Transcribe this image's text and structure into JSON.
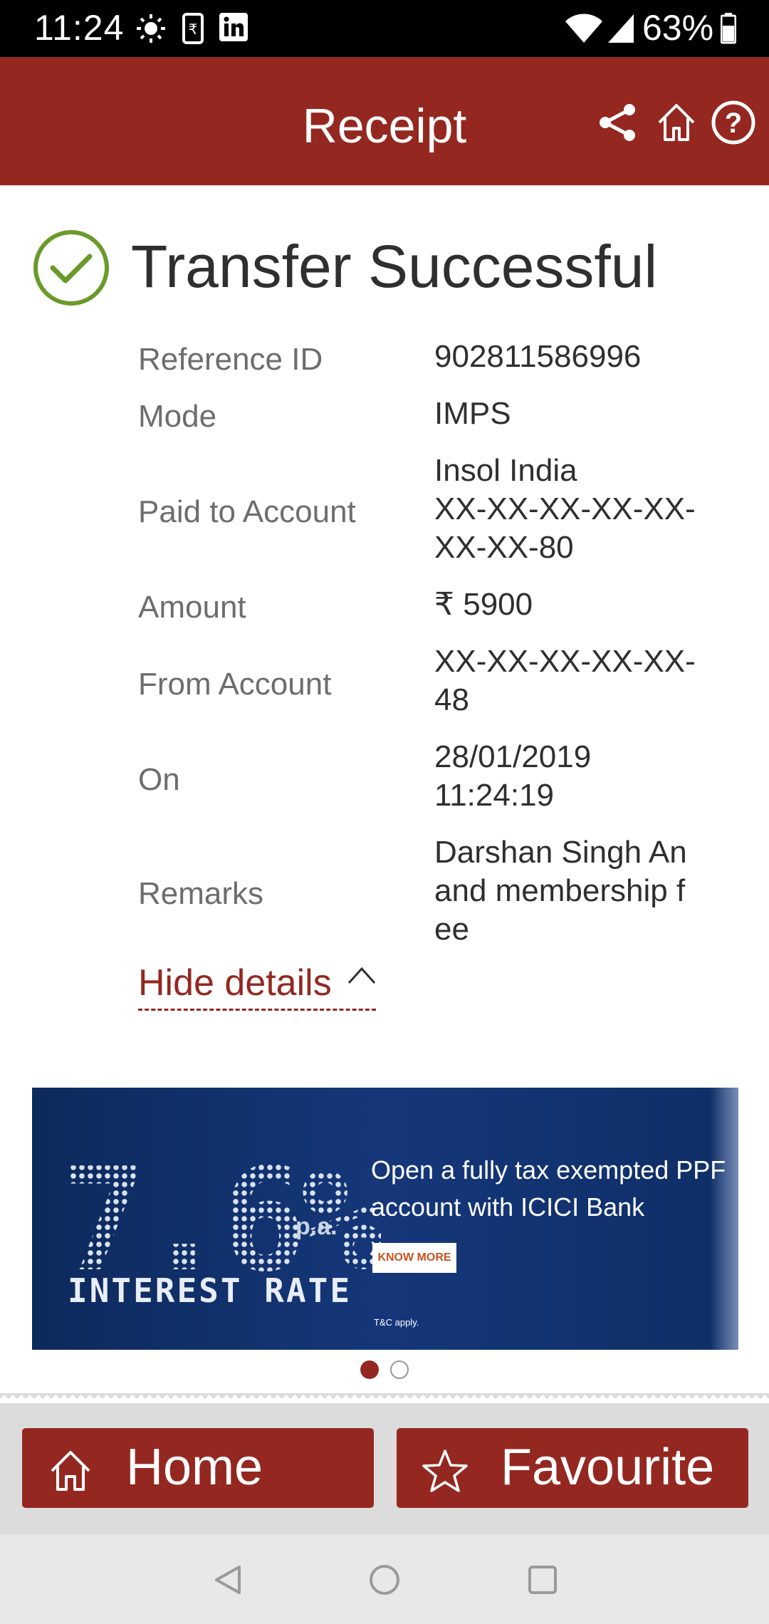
{
  "status_bar": {
    "time": "11:24",
    "battery": "63%"
  },
  "header": {
    "title": "Receipt"
  },
  "receipt": {
    "status": "Transfer Successful",
    "rows": [
      {
        "label": "Reference ID",
        "value": "902811586996"
      },
      {
        "label": "Mode",
        "value": "IMPS"
      },
      {
        "label": "Paid to Account",
        "value": "Insol India\nXX-XX-XX-XX-XX-\nXX-XX-80"
      },
      {
        "label": "Amount",
        "value": "₹ 5900"
      },
      {
        "label": "From Account",
        "value": "XX-XX-XX-XX-XX-\n48"
      },
      {
        "label": "On",
        "value": "28/01/2019\n11:24:19"
      },
      {
        "label": "Remarks",
        "value": "Darshan Singh An\nand membership f\nee"
      }
    ],
    "toggle_label": "Hide details"
  },
  "banner": {
    "rate": "7.6%",
    "rate_suffix": "p.a.",
    "rate_caption": "INTEREST RATE",
    "text": "Open a fully tax exempted PPF account with ICICI Bank",
    "cta": "KNOW MORE",
    "fine_print": "T&C apply."
  },
  "carousel": {
    "count": 2,
    "active": 1
  },
  "bottom_buttons": {
    "home": "Home",
    "favourite": "Favourite"
  },
  "colors": {
    "brand": "#942821",
    "success": "#6a9a2a"
  }
}
